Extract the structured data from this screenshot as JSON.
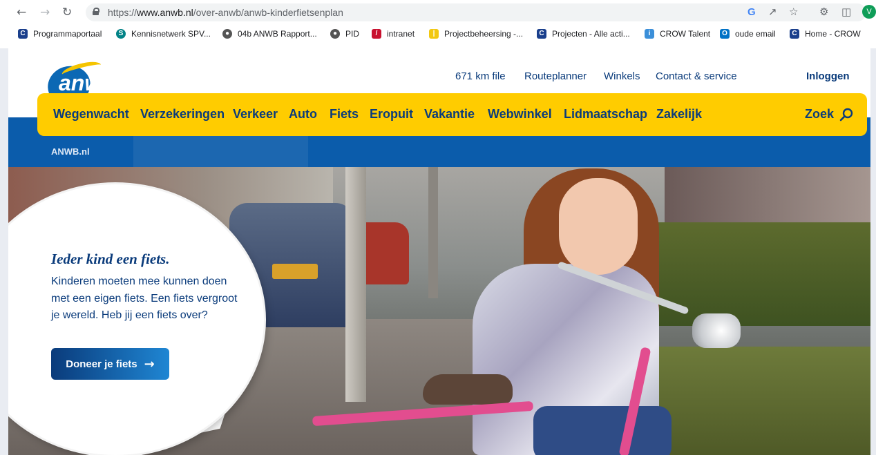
{
  "browser": {
    "url_prefix": "https://",
    "url_host": "www.anwb.nl",
    "url_path": "/over-anwb/anwb-kinderfietsenplan",
    "avatar_letter": "V",
    "bookmarks": [
      {
        "label": "Programmaportaal",
        "icon": "crow-icon",
        "color": "#1a3f8c"
      },
      {
        "label": "Kennisnetwerk SPV...",
        "icon": "sharepoint-icon",
        "color": "#038387"
      },
      {
        "label": "04b ANWB Rapport...",
        "icon": "globe-icon",
        "color": "#555555"
      },
      {
        "label": "PID",
        "icon": "globe-icon",
        "color": "#555555"
      },
      {
        "label": "intranet",
        "icon": "intranet-icon",
        "color": "#c8102e"
      },
      {
        "label": "Projectbeheersing -...",
        "icon": "powerbi-icon",
        "color": "#f2c811"
      },
      {
        "label": "Projecten - Alle acti...",
        "icon": "crow-icon",
        "color": "#1a3f8c"
      },
      {
        "label": "CROW Talent",
        "icon": "ig-icon",
        "color": "#3b8fd9"
      },
      {
        "label": "oude email",
        "icon": "outlook-icon",
        "color": "#0072c6"
      },
      {
        "label": "Home - CROW",
        "icon": "crow-icon",
        "color": "#1a3f8c"
      }
    ]
  },
  "site": {
    "logo_text": "anwb",
    "top_links": [
      "671 km file",
      "Routeplanner",
      "Winkels",
      "Contact & service"
    ],
    "login": "Inloggen",
    "menu": [
      "Wegenwacht",
      "Verzekeringen",
      "Verkeer",
      "Auto",
      "Fiets",
      "Eropuit",
      "Vakantie",
      "Webwinkel",
      "Lidmaatschap",
      "Zakelijk"
    ],
    "search_label": "Zoek",
    "breadcrumb": "ANWB.nl",
    "colors": {
      "brand_blue": "#0b5cab",
      "brand_yellow": "#ffcc00",
      "text_navy": "#0a3b7b"
    }
  },
  "hero": {
    "headline": "Ieder kind een fiets.",
    "body": "Kinderen moeten mee kunnen doen met een eigen fiets. Een fiets vergroot je wereld. Heb jij een fiets over?",
    "cta_label": "Doneer je fiets",
    "cta_icon": "arrow-right-icon"
  }
}
